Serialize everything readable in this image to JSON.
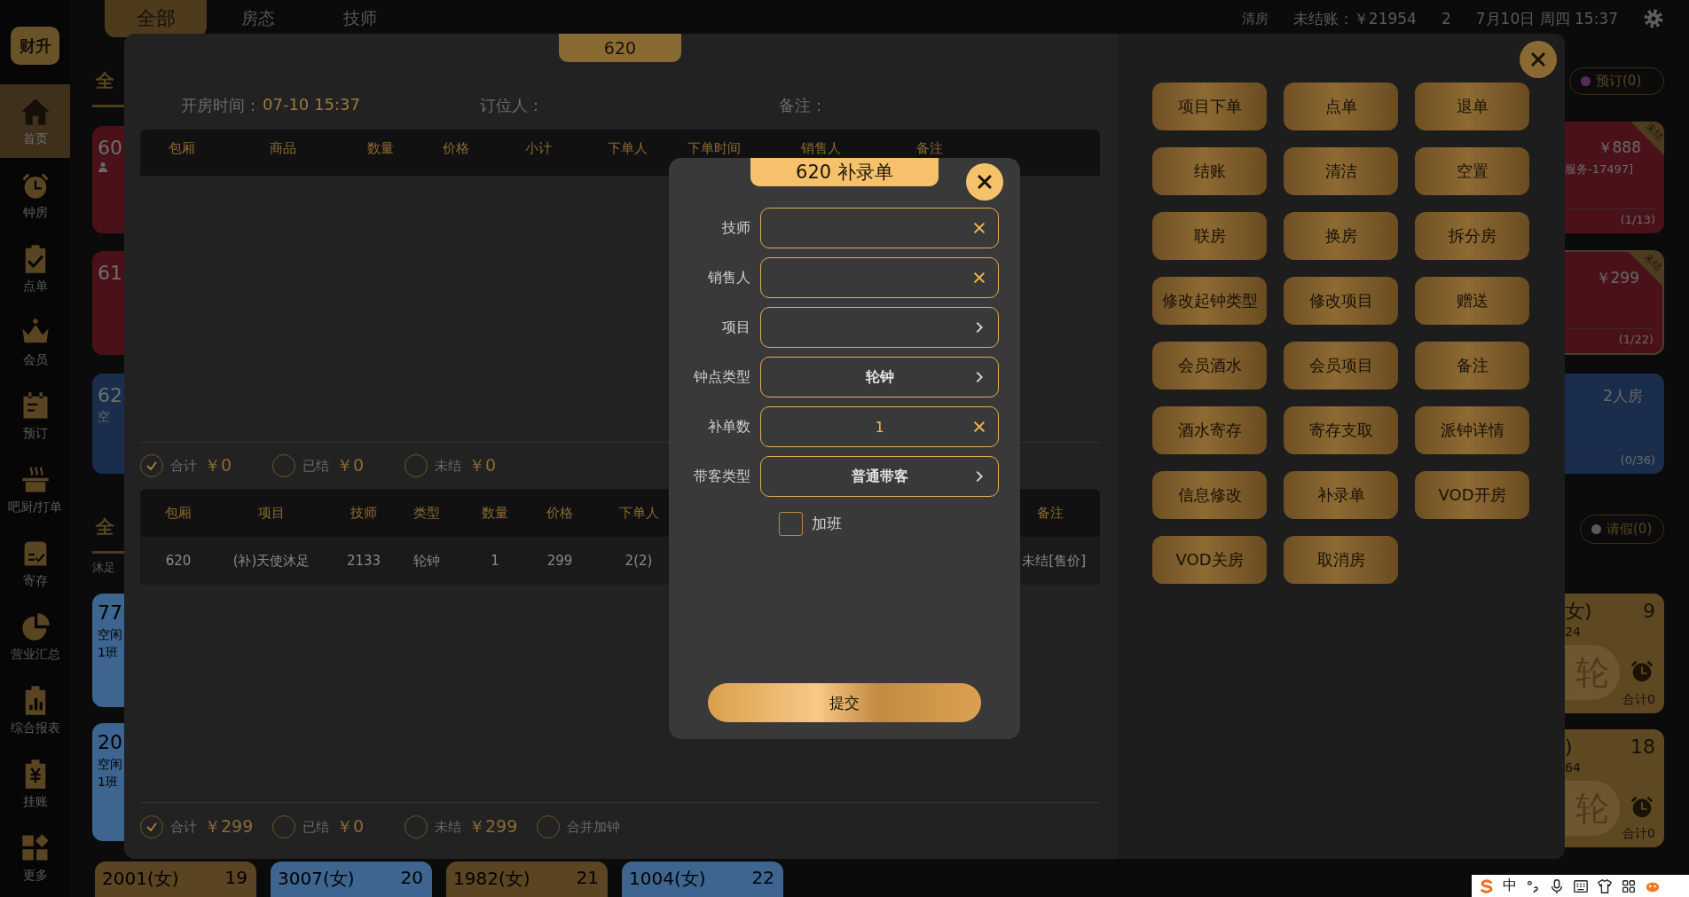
{
  "sidebar": {
    "logo": "财升",
    "items": [
      {
        "label": "首页",
        "selected": true
      },
      {
        "label": "钟房",
        "selected": false
      },
      {
        "label": "点单",
        "selected": false
      },
      {
        "label": "会员",
        "selected": false
      },
      {
        "label": "预订",
        "selected": false
      },
      {
        "label": "吧厨/打单",
        "selected": false
      },
      {
        "label": "寄存",
        "selected": false
      },
      {
        "label": "营业汇总",
        "selected": false
      },
      {
        "label": "综合报表",
        "selected": false
      },
      {
        "label": "挂账",
        "selected": false
      },
      {
        "label": "更多",
        "selected": false
      }
    ]
  },
  "top_bar": {
    "tabs": [
      {
        "label": "全部",
        "selected": true
      },
      {
        "label": "房态",
        "selected": false
      },
      {
        "label": "技师",
        "selected": false
      }
    ],
    "status": [
      "清房",
      "未结账：￥21954",
      "2",
      "7月10日 周四 15:37"
    ]
  },
  "room_board": {
    "left": {
      "section_tab": "全",
      "rooms": [
        {
          "number": "60",
          "guests": true,
          "color": "#4a1119"
        },
        {
          "number": "61",
          "color": "#4a1119"
        },
        {
          "number": "62",
          "status": "空",
          "color": "#1a2d4c"
        }
      ],
      "tech_tab": "全",
      "category": "沐足",
      "techs": [
        {
          "number": "77",
          "status": "空闲",
          "shift": "1班"
        },
        {
          "number": "20",
          "status": "空闲",
          "shift": "1班"
        }
      ]
    },
    "right": {
      "booking_pill": "预订(0)",
      "rooms": [
        {
          "price": "￥888",
          "note": "服务-17497]",
          "ratio": "(1/13)",
          "ribbon": "未结",
          "color": "#4a1119"
        },
        {
          "price": "￥299",
          "ratio": "(1/22)",
          "ribbon": "未结",
          "color": "#4a1119"
        },
        {
          "room_type": "2人房",
          "ratio": "(0/36)",
          "color": "#1a2d4c"
        }
      ],
      "leave_pill": "请假(0)",
      "techs": [
        {
          "name": "女)",
          "count": "9",
          "code": "24",
          "badge": "轮",
          "total": "合计0"
        },
        {
          "name": ")",
          "count": "18",
          "code": "64",
          "badge": "轮",
          "total": "合计0"
        }
      ]
    },
    "bottom_techs": [
      {
        "name": "2001(女)",
        "count": "19",
        "color": "#5a4421"
      },
      {
        "name": "3007(女)",
        "count": "20",
        "color": "#3d6590"
      },
      {
        "name": "1982(女)",
        "count": "21",
        "color": "#5a4421"
      },
      {
        "name": "1004(女)",
        "count": "22",
        "color": "#3d6590"
      }
    ]
  },
  "order_modal": {
    "room": "620",
    "info": [
      {
        "label": "开房时间：",
        "value": "07-10 15:37"
      },
      {
        "label": "订位人："
      },
      {
        "label": "备注："
      }
    ],
    "goods_table": {
      "columns": [
        "包厢",
        "商品",
        "数量",
        "价格",
        "小计",
        "下单人",
        "下单时间",
        "销售人",
        "备注"
      ]
    },
    "goods_summary": [
      {
        "label": "合计",
        "amount": "￥0",
        "checked": true
      },
      {
        "label": "已结",
        "amount": "￥0",
        "checked": false
      },
      {
        "label": "未结",
        "amount": "￥0",
        "checked": false
      }
    ],
    "items_table": {
      "columns": [
        "包厢",
        "项目",
        "技师",
        "类型",
        "数量",
        "价格",
        "下单人",
        "备注"
      ],
      "rows": [
        [
          "620",
          "(补)天使沐足",
          "2133",
          "轮钟",
          "1",
          "299",
          "2(2)",
          "未结[售价]"
        ]
      ]
    },
    "items_summary": [
      {
        "label": "合计",
        "amount": "￥299",
        "checked": true
      },
      {
        "label": "已结",
        "amount": "￥0",
        "checked": false
      },
      {
        "label": "未结",
        "amount": "￥299",
        "checked": false
      },
      {
        "label": "合并加钟",
        "checked": false
      }
    ],
    "actions": [
      "项目下单",
      "点单",
      "退单",
      "结账",
      "清洁",
      "空置",
      "联房",
      "换房",
      "拆分房",
      "修改起钟类型",
      "修改项目",
      "赠送",
      "会员酒水",
      "会员项目",
      "备注",
      "酒水寄存",
      "寄存支取",
      "派钟详情",
      "信息修改",
      "补录单",
      "VOD开房",
      "VOD关房",
      "取消房"
    ]
  },
  "supplement_dialog": {
    "title": "620 补录单",
    "fields": [
      {
        "label": "技师",
        "kind": "clear"
      },
      {
        "label": "销售人",
        "kind": "clear"
      },
      {
        "label": "项目",
        "kind": "select"
      },
      {
        "label": "钟点类型",
        "kind": "select",
        "value": "轮钟"
      },
      {
        "label": "补单数",
        "kind": "clear",
        "value": "1"
      },
      {
        "label": "带客类型",
        "kind": "select",
        "value": "普通带客"
      }
    ],
    "overtime": {
      "label": "加班",
      "checked": false
    },
    "submit": "提交"
  },
  "ime_toolbar": {
    "mode": "中"
  }
}
